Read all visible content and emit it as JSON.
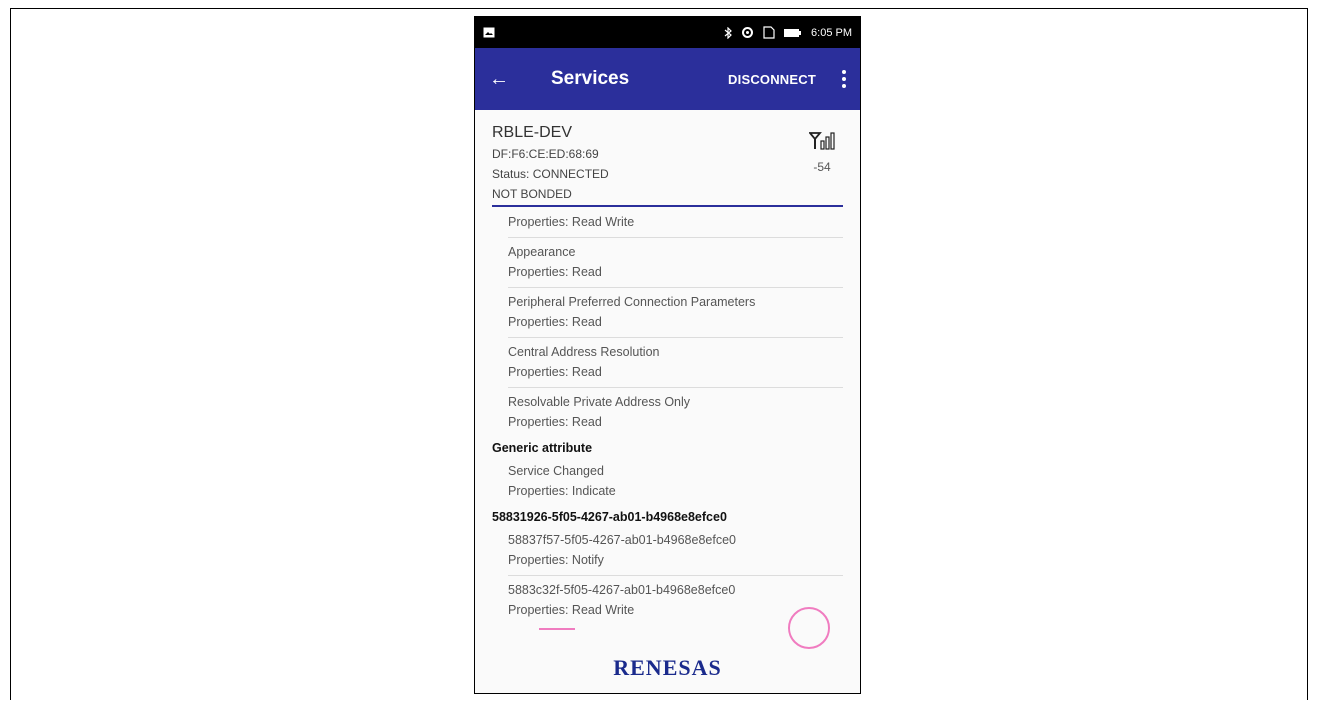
{
  "status_bar": {
    "time": "6:05 PM"
  },
  "app_bar": {
    "title": "Services",
    "disconnect_label": "DISCONNECT"
  },
  "device": {
    "name": "RBLE-DEV",
    "address": "DF:F6:CE:ED:68:69",
    "status": "Status:  CONNECTED",
    "bond": "NOT BONDED",
    "rssi": "-54"
  },
  "items": [
    {
      "kind": "char",
      "props": "Properties: Read Write"
    },
    {
      "kind": "char",
      "name": "Appearance",
      "props": "Properties: Read"
    },
    {
      "kind": "char",
      "name": "Peripheral Preferred Connection Parameters",
      "props": "Properties: Read"
    },
    {
      "kind": "char",
      "name": "Central Address Resolution",
      "props": "Properties: Read"
    },
    {
      "kind": "char",
      "name": "Resolvable Private Address Only",
      "props": "Properties: Read"
    },
    {
      "kind": "service",
      "name": "Generic attribute"
    },
    {
      "kind": "char",
      "name": "Service Changed",
      "props": "Properties: Indicate"
    },
    {
      "kind": "service",
      "name": "58831926-5f05-4267-ab01-b4968e8efce0"
    },
    {
      "kind": "char",
      "name": "58837f57-5f05-4267-ab01-b4968e8efce0",
      "props": "Properties: Notify"
    },
    {
      "kind": "char",
      "name": "5883c32f-5f05-4267-ab01-b4968e8efce0",
      "props": "Properties: Read Write"
    }
  ],
  "logo": "RENESAS",
  "colors": {
    "app_bar": "#2b2f9b",
    "accent_mark": "#f07cc0"
  }
}
